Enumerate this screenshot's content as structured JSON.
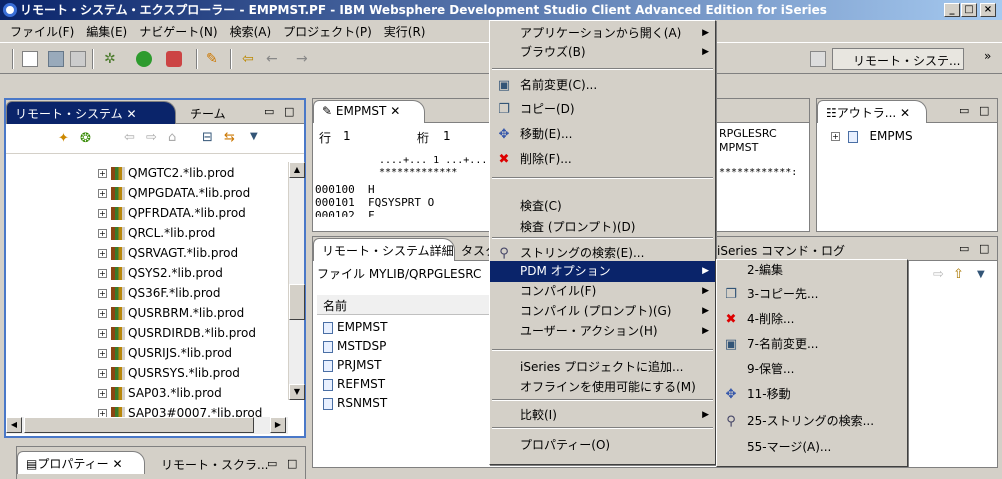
{
  "window": {
    "title": "リモート・システム・エクスプローラー - EMPMST.PF - IBM Websphere Development Studio Client Advanced Edition for iSeries",
    "minimize": "_",
    "maximize": "□",
    "close": "×"
  },
  "menubar": [
    "ファイル(F)",
    "編集(E)",
    "ナビゲート(N)",
    "検索(A)",
    "プロジェクト(P)",
    "実行(R)"
  ],
  "toolbar": {
    "perspective_label": "リモート・システ...",
    "overflow": "»"
  },
  "left_panel": {
    "tab_active": "リモート・システム",
    "tab_other": "チーム",
    "tree_items": [
      "QMGTC2.*lib.prod",
      "QMPGDATA.*lib.prod",
      "QPFRDATA.*lib.prod",
      "QRCL.*lib.prod",
      "QSRVAGT.*lib.prod",
      "QSYS2.*lib.prod",
      "QS36F.*lib.prod",
      "QUSRBRM.*lib.prod",
      "QUSRDIRDB.*lib.prod",
      "QUSRIJS.*lib.prod",
      "QUSRSYS.*lib.prod",
      "SAP03.*lib.prod",
      "SAP03#0007.*lib.prod"
    ]
  },
  "bottom_left_panel": {
    "tab_active": "プロパティー",
    "tab_other": "リモート・スクラ..."
  },
  "editor": {
    "tab_label": "EMPMST",
    "row_label": "行",
    "row_value": "1",
    "col_label": "桁",
    "col_value": "1",
    "ruler": "....+... 1 ...+... 2 ...+... 3",
    "stars": "*************",
    "right_text_1": "RPGLESRC",
    "right_text_2": "MPMST",
    "right_stars": "************:",
    "lines": [
      {
        "num": "000100",
        "text": "H"
      },
      {
        "num": "000101",
        "text": "FQSYSPRT O"
      },
      {
        "num": "000102",
        "text": "F"
      }
    ]
  },
  "outline_panel": {
    "tab_label": "アウトラ...",
    "item": "EMPMS"
  },
  "detail_panel": {
    "tab_active": "リモート・システム詳細",
    "tab_other": "タスク",
    "tab_right": "iSeries コマンド・ログ",
    "path_label": "ファイル MYLIB/QRPGLESRC",
    "column_header": "名前",
    "rows": [
      "EMPMST",
      "MSTDSP",
      "PRJMST",
      "REFMST",
      "RSNMST"
    ]
  },
  "context_menu": {
    "items": [
      {
        "label": "アプリケーションから開く(A)",
        "submenu": true
      },
      {
        "label": "ブラウズ(B)",
        "submenu": true
      },
      {
        "label": "名前変更(C)...",
        "icon": "rename-icon"
      },
      {
        "label": "コピー(D)",
        "icon": "copy-icon"
      },
      {
        "label": "移動(E)...",
        "icon": "move-icon"
      },
      {
        "label": "削除(F)...",
        "icon": "delete-icon"
      },
      {
        "label": "検査(C)"
      },
      {
        "label": "検査 (プロンプト)(D)"
      },
      {
        "label": "ストリングの検索(E)...",
        "icon": "search-string-icon"
      },
      {
        "label": "PDM オプション",
        "submenu": true,
        "selected": true
      },
      {
        "label": "コンパイル(F)",
        "submenu": true
      },
      {
        "label": "コンパイル (プロンプト)(G)",
        "submenu": true
      },
      {
        "label": "ユーザー・アクション(H)",
        "submenu": true
      },
      {
        "label": "iSeries プロジェクトに追加..."
      },
      {
        "label": "オフラインを使用可能にする(M)"
      },
      {
        "label": "比較(I)",
        "submenu": true
      },
      {
        "label": "プロパティー(O)"
      }
    ]
  },
  "pdm_submenu": {
    "items": [
      {
        "label": "2-編集"
      },
      {
        "label": "3-コピー先...",
        "icon": "copy-icon"
      },
      {
        "label": "4-削除...",
        "icon": "delete-icon"
      },
      {
        "label": "7-名前変更...",
        "icon": "rename-icon"
      },
      {
        "label": "9-保管..."
      },
      {
        "label": "11-移動",
        "icon": "move-icon"
      },
      {
        "label": "25-ストリングの検索...",
        "icon": "search-string-icon"
      },
      {
        "label": "55-マージ(A)..."
      }
    ]
  }
}
